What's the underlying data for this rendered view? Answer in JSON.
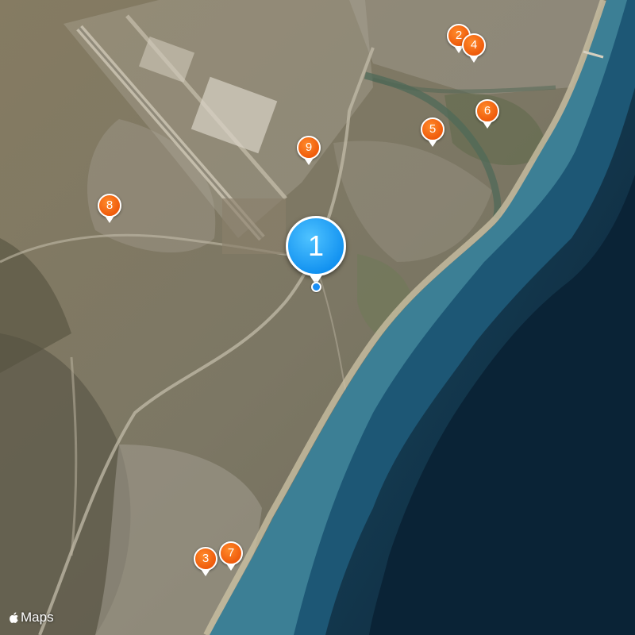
{
  "map": {
    "attribution_label": "Maps",
    "attribution_icon": "apple-logo-icon",
    "colors": {
      "sea_deep": "#0e2a40",
      "sea_shallow": "#2f6f86",
      "land": "#7d7760",
      "pin_orange": "#ef5b0c",
      "pin_blue": "#1090f0"
    }
  },
  "pins": {
    "primary": {
      "label": "1"
    },
    "p2": {
      "label": "2"
    },
    "p3": {
      "label": "3"
    },
    "p4": {
      "label": "4"
    },
    "p5": {
      "label": "5"
    },
    "p6": {
      "label": "6"
    },
    "p7": {
      "label": "7"
    },
    "p8": {
      "label": "8"
    },
    "p9": {
      "label": "9"
    }
  }
}
